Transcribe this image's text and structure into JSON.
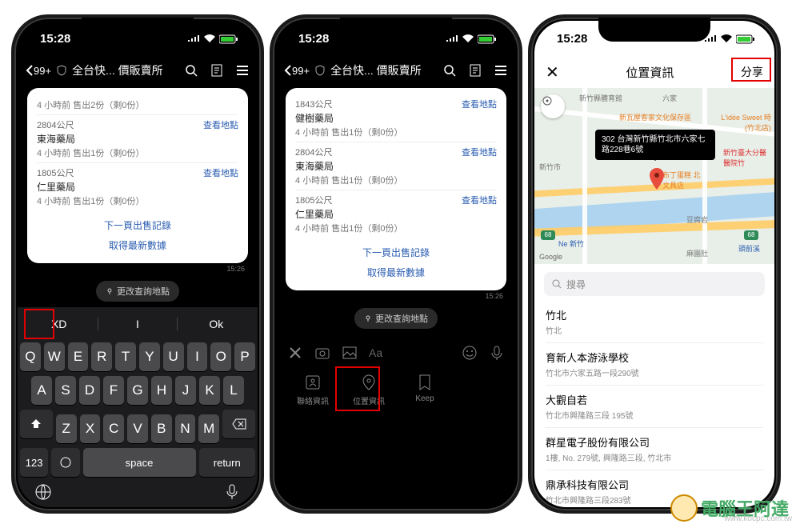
{
  "status": {
    "time": "15:28"
  },
  "header": {
    "back_count": "99+",
    "title": "全台快... 價販賣所",
    "search_icon": "search",
    "list_icon": "list",
    "menu_icon": "menu"
  },
  "card1": {
    "rows": [
      {
        "dist": "",
        "name": "",
        "sub": "4 小時前 售出2份（剩0份）"
      },
      {
        "dist": "2804公尺",
        "name": "東海藥局",
        "sub": "4 小時前 售出1份（剩0份）"
      },
      {
        "dist": "1805公尺",
        "name": "仁里藥局",
        "sub": "4 小時前 售出1份（剩0份）"
      }
    ],
    "view": "查看地點",
    "next": "下一頁出售記錄",
    "refresh": "取得最新數據",
    "ts": "15:26"
  },
  "card2": {
    "rows": [
      {
        "dist": "1843公尺",
        "name": "健樹藥局",
        "sub": "4 小時前 售出1份（剩0份）"
      },
      {
        "dist": "2804公尺",
        "name": "東海藥局",
        "sub": "4 小時前 售出1份（剩0份）"
      },
      {
        "dist": "1805公尺",
        "name": "仁里藥局",
        "sub": "4 小時前 售出1份（剩0份）"
      }
    ],
    "view": "查看地點",
    "next": "下一頁出售記錄",
    "refresh": "取得最新數據",
    "ts": "15:26"
  },
  "change_loc": "更改查詢地點",
  "input_placeholder": "Aa",
  "attach": {
    "contact": "聯絡資訊",
    "location": "位置資訊",
    "keep": "Keep"
  },
  "keyboard": {
    "suggestions": [
      "XD",
      "I",
      "Ok"
    ],
    "r1": [
      "Q",
      "W",
      "E",
      "R",
      "T",
      "Y",
      "U",
      "I",
      "O",
      "P"
    ],
    "r2": [
      "A",
      "S",
      "D",
      "F",
      "G",
      "H",
      "J",
      "K",
      "L"
    ],
    "r3": [
      "Z",
      "X",
      "C",
      "V",
      "B",
      "N",
      "M"
    ],
    "num": "123",
    "space": "space",
    "ret": "return"
  },
  "light": {
    "title": "位置資訊",
    "share": "分享",
    "tooltip": "302 台灣新竹縣竹北市六家七路228巷6號",
    "google": "Google",
    "search_ph": "搜尋",
    "pois": {
      "p1": "新竹縣體育館",
      "p2": "六家",
      "p3": "新瓦屋客家文化保存區",
      "p4": "L'idée Sweet 時(竹北店)",
      "p5": "新竹臺大分醫醫院竹",
      "p6": "布丁蛋糕 北文具店",
      "p7": "豆腐岩",
      "p8": "麻園肚",
      "p9": "新竹市",
      "p10": "頭前溪",
      "p11": "Ne 新竹",
      "h1": "68",
      "h2": "68"
    },
    "list": [
      {
        "n": "竹北",
        "a": "竹北"
      },
      {
        "n": "育新人本游泳學校",
        "a": "竹北市六家五路一段290號"
      },
      {
        "n": "大觀自若",
        "a": "竹北市興隆路三段 195號"
      },
      {
        "n": "群星電子股份有限公司",
        "a": "1樓, No. 279號, 興隆路三段, 竹北市"
      },
      {
        "n": "鼎承科技有限公司",
        "a": "竹北市興隆路三段283號"
      }
    ]
  },
  "watermark": "www.kocpc.com.tw",
  "brand": "電腦王阿達"
}
